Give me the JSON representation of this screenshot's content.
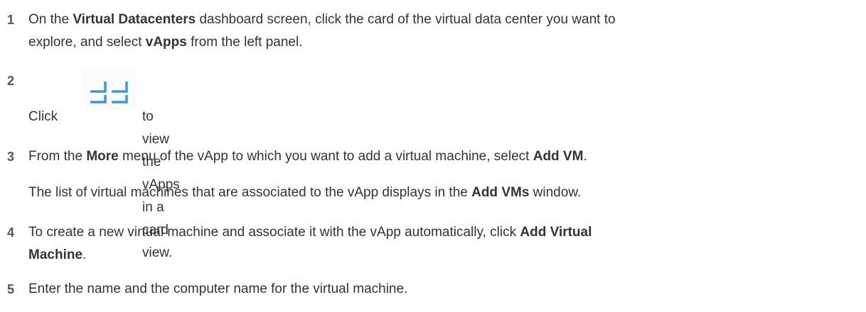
{
  "steps": [
    {
      "number": "1",
      "line1_pre": "On the ",
      "line1_bold1": "Virtual Datacenters",
      "line1_mid": " dashboard screen, click the card of the virtual data center you want to",
      "line2_pre": "explore, and select ",
      "line2_bold": "vApps",
      "line2_post": " from the left panel."
    },
    {
      "number": "2",
      "pre": "Click",
      "post": "to view the vApps in a card view.",
      "icon": "card-view-icon",
      "icon_color": "#3b9ad9"
    },
    {
      "number": "3",
      "pre": "From the ",
      "bold1": "More",
      "mid": " menu of the vApp to which you want to add a virtual machine, select ",
      "bold2": "Add VM",
      "post": ".",
      "note_pre": "The list of virtual machines that are associated to the vApp displays in the ",
      "note_bold": "Add VMs",
      "note_post": " window."
    },
    {
      "number": "4",
      "line1_pre": "To create a new virtual machine and associate it with the vApp automatically, click ",
      "line1_bold": "Add Virtual",
      "line2_bold": "Machine",
      "line2_post": "."
    },
    {
      "number": "5",
      "text": "Enter the name and the computer name for the virtual machine."
    }
  ]
}
